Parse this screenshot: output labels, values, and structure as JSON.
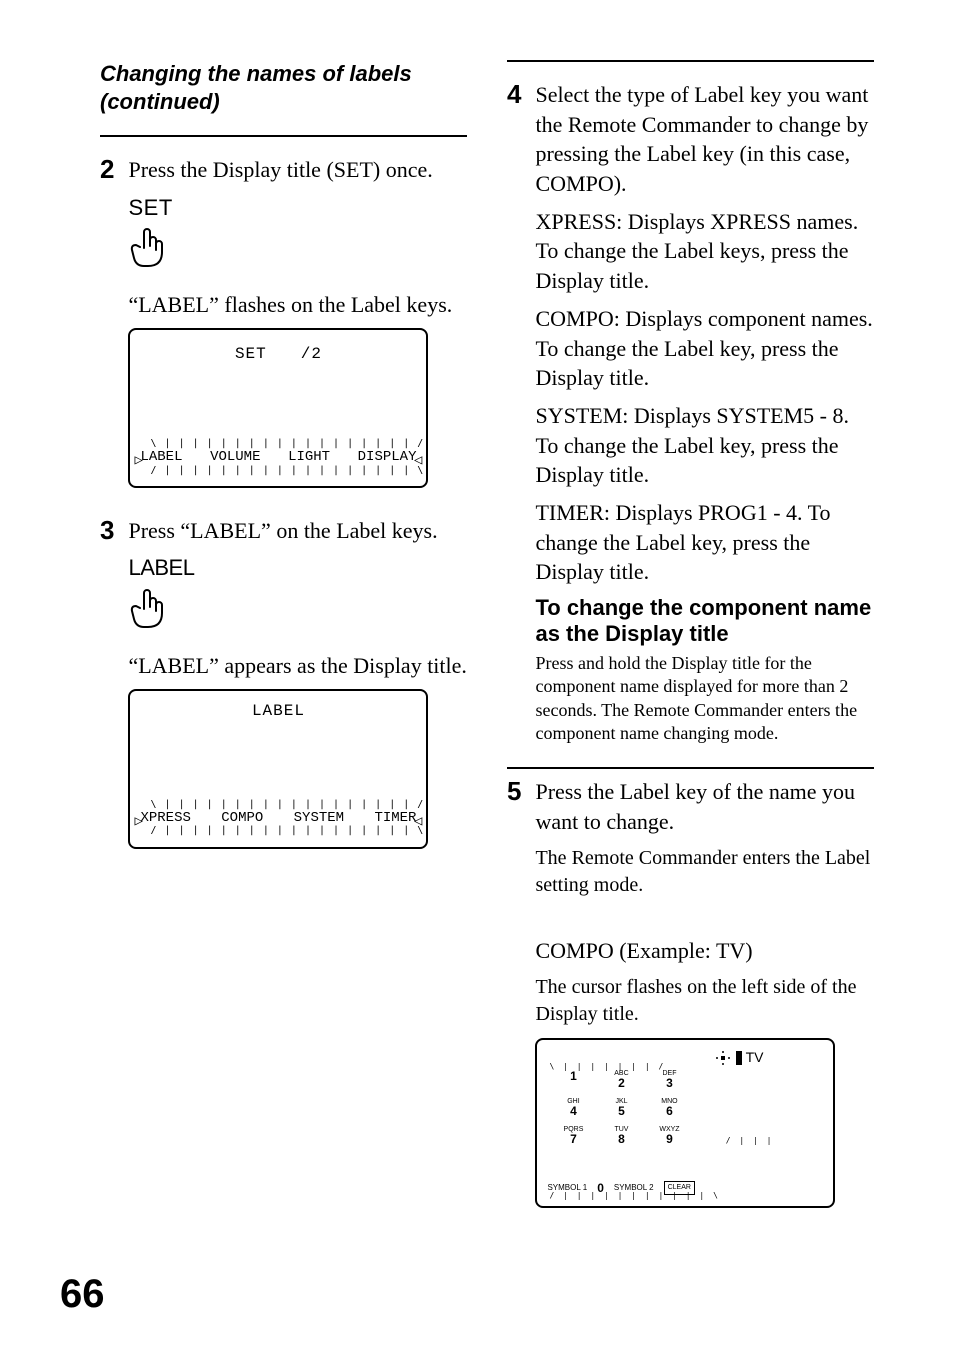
{
  "page_number": "66",
  "left": {
    "heading": "Changing the names of labels (continued)",
    "step2": {
      "num": "2",
      "text": "Press the Display title (SET) once.",
      "label": "SET",
      "caption": "“LABEL” flashes on the Label keys.",
      "lcd_top": "SET  /2",
      "keyrow": [
        "LABEL",
        "VOLUME",
        "LIGHT",
        "DISPLAY"
      ]
    },
    "step3": {
      "num": "3",
      "text": "Press “LABEL” on the Label keys.",
      "label": "LABEL",
      "caption": "“LABEL” appears as the Display title.",
      "lcd_top": "LABEL",
      "keyrow": [
        "XPRESS",
        "COMPO",
        "SYSTEM",
        "TIMER"
      ]
    }
  },
  "right": {
    "step4": {
      "num": "4",
      "text": "Select the type of Label key you want the Remote Commander to change by pressing the Label key (in this case, COMPO).",
      "lines": [
        "XPRESS: Displays XPRESS names. To change the Label keys, press the Display title.",
        "COMPO: Displays component names. To change the Label key, press the Display title.",
        "SYSTEM: Displays SYSTEM5 - 8. To change the Label key, press the Display title.",
        "TIMER: Displays PROG1 - 4. To change the Label key, press the Display title."
      ],
      "sub_heading": "To change the component name as the Display title",
      "sub_text": "Press and hold the Display title for the component name displayed for more than 2 seconds. The Remote Commander enters the component name changing mode."
    },
    "step5": {
      "num": "5",
      "text": "Press the Label key of the name you want to change.",
      "line1": "The Remote Commander enters the Label setting mode.",
      "compo_title": "COMPO (Example: TV)",
      "compo_text": "The cursor flashes on the left side of the Display title.",
      "tv_label": "TV",
      "keypad": [
        {
          "sup": "",
          "num": "1"
        },
        {
          "sup": "ABC",
          "num": "2"
        },
        {
          "sup": "DEF",
          "num": "3"
        },
        {
          "sup": "GHI",
          "num": "4"
        },
        {
          "sup": "JKL",
          "num": "5"
        },
        {
          "sup": "MNO",
          "num": "6"
        },
        {
          "sup": "PQRS",
          "num": "7"
        },
        {
          "sup": "TUV",
          "num": "8"
        },
        {
          "sup": "WXYZ",
          "num": "9"
        }
      ],
      "sym1": "SYMBOL 1",
      "zero": "0",
      "sym2": "SYMBOL 2",
      "clear": "CLEAR"
    }
  }
}
